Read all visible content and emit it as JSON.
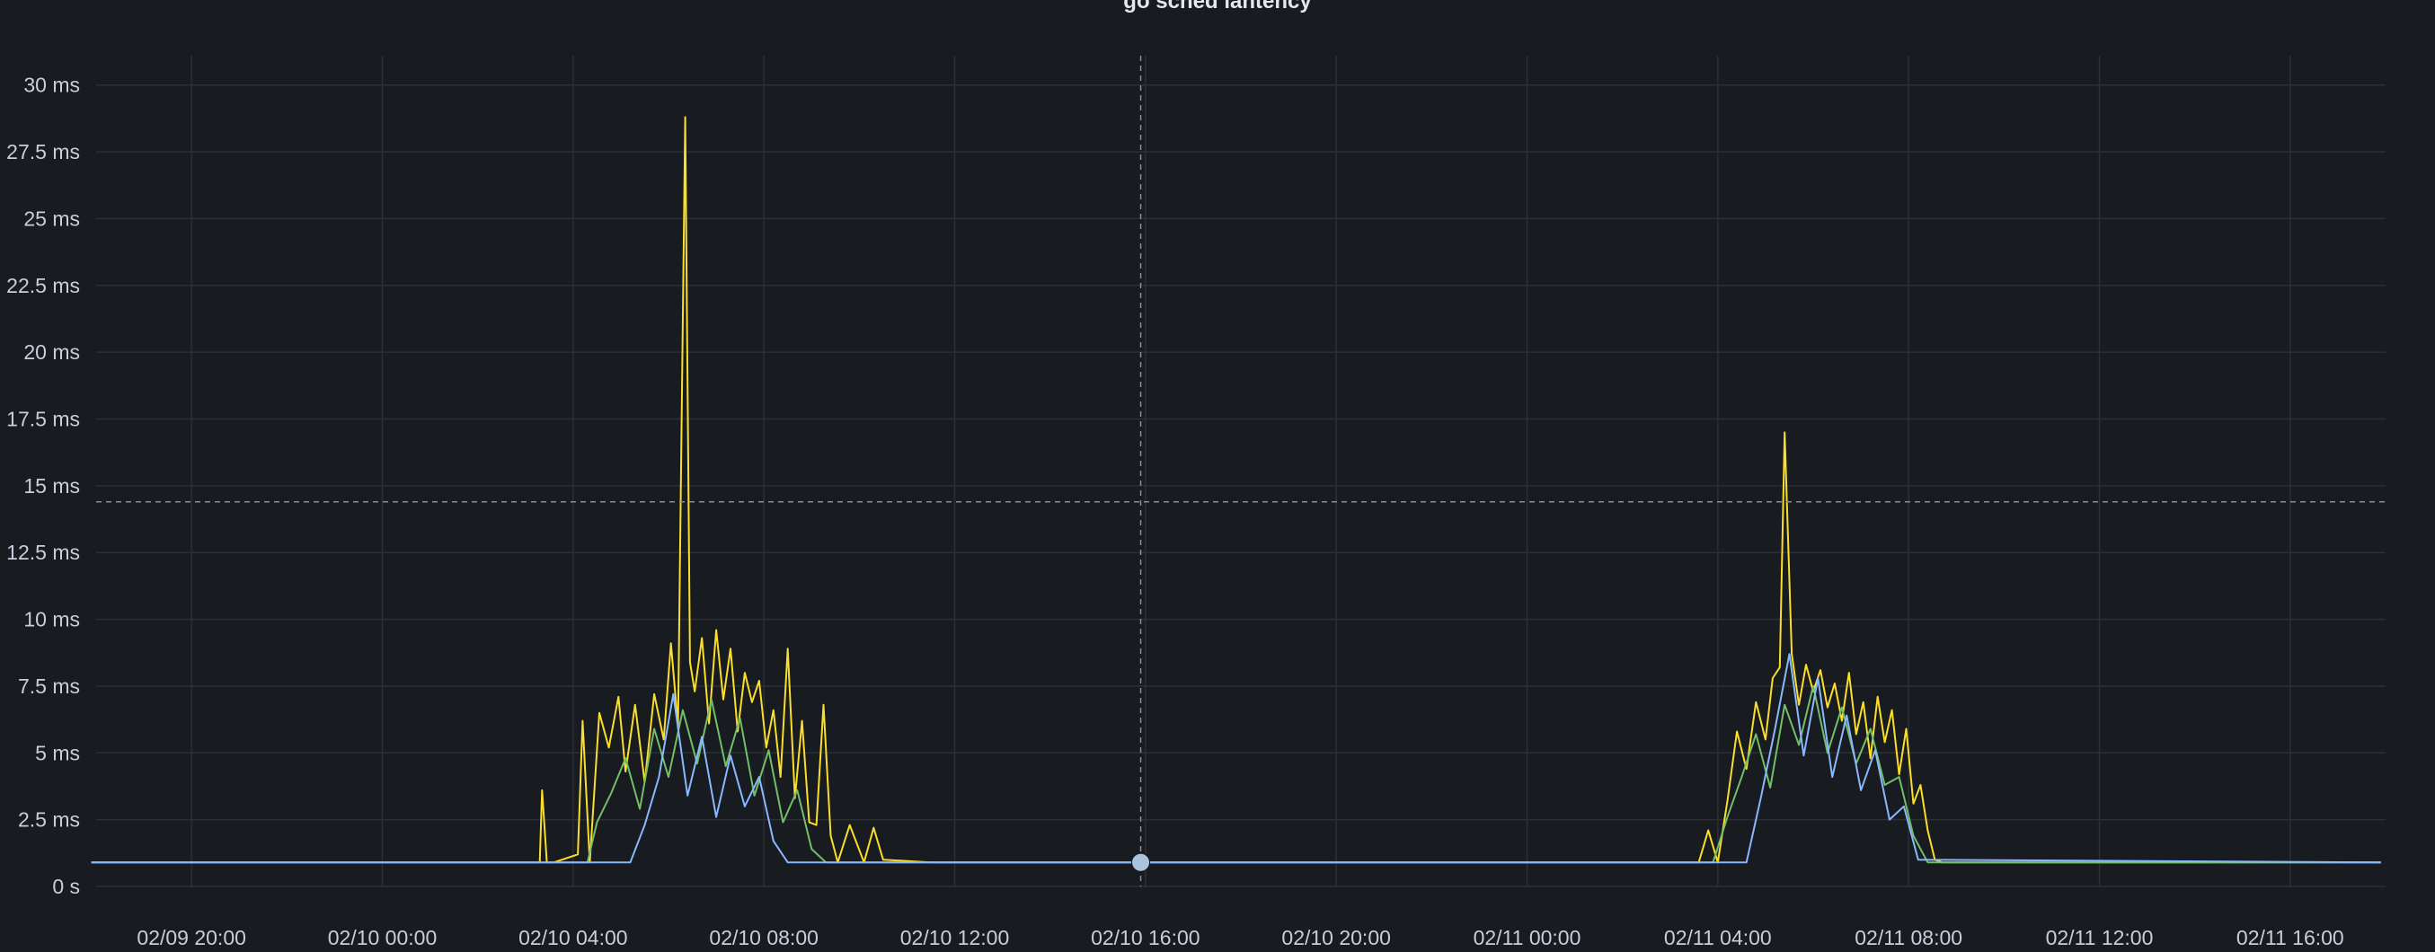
{
  "panel": {
    "title": "go sched lantency"
  },
  "chart_data": {
    "type": "line",
    "title": "go sched lantency",
    "xlabel": "",
    "ylabel": "",
    "ylim_ms": [
      0,
      31
    ],
    "y_ticks": [
      {
        "value_ms": 0,
        "label": "0 s"
      },
      {
        "value_ms": 2.5,
        "label": "2.5 ms"
      },
      {
        "value_ms": 5,
        "label": "5 ms"
      },
      {
        "value_ms": 7.5,
        "label": "7.5 ms"
      },
      {
        "value_ms": 10,
        "label": "10 ms"
      },
      {
        "value_ms": 12.5,
        "label": "12.5 ms"
      },
      {
        "value_ms": 15,
        "label": "15 ms"
      },
      {
        "value_ms": 17.5,
        "label": "17.5 ms"
      },
      {
        "value_ms": 20,
        "label": "20 ms"
      },
      {
        "value_ms": 22.5,
        "label": "22.5 ms"
      },
      {
        "value_ms": 25,
        "label": "25 ms"
      },
      {
        "value_ms": 27.5,
        "label": "27.5 ms"
      },
      {
        "value_ms": 30,
        "label": "30 ms"
      }
    ],
    "xlim": [
      "02/09 18:00",
      "02/11 18:00"
    ],
    "x_ticks": [
      {
        "hour": 20,
        "label": "02/09 20:00"
      },
      {
        "hour": 24,
        "label": "02/10 00:00"
      },
      {
        "hour": 28,
        "label": "02/10 04:00"
      },
      {
        "hour": 32,
        "label": "02/10 08:00"
      },
      {
        "hour": 36,
        "label": "02/10 12:00"
      },
      {
        "hour": 40,
        "label": "02/10 16:00"
      },
      {
        "hour": 44,
        "label": "02/10 20:00"
      },
      {
        "hour": 48,
        "label": "02/11 00:00"
      },
      {
        "hour": 52,
        "label": "02/11 04:00"
      },
      {
        "hour": 56,
        "label": "02/11 08:00"
      },
      {
        "hour": 60,
        "label": "02/11 12:00"
      },
      {
        "hour": 64,
        "label": "02/11 16:00"
      }
    ],
    "grid": true,
    "legend": "none",
    "crosshair": {
      "x_hour": 39.9,
      "y_ms": 14.4
    },
    "series": [
      {
        "color": "#fade2a",
        "x_hours": [
          17.9,
          26.3,
          27.3,
          27.35,
          27.45,
          27.6,
          28.1,
          28.2,
          28.35,
          28.55,
          28.75,
          28.95,
          29.1,
          29.3,
          29.5,
          29.7,
          29.9,
          30.05,
          30.2,
          30.35,
          30.45,
          30.55,
          30.7,
          30.85,
          31.0,
          31.15,
          31.3,
          31.45,
          31.6,
          31.75,
          31.9,
          32.05,
          32.2,
          32.35,
          32.5,
          32.65,
          32.8,
          32.95,
          33.1,
          33.25,
          33.4,
          33.55,
          33.8,
          34.1,
          34.3,
          34.5,
          35.5,
          49.5,
          51.6,
          51.8,
          52.0,
          52.2,
          52.4,
          52.6,
          52.8,
          53.0,
          53.15,
          53.3,
          53.4,
          53.55,
          53.7,
          53.85,
          54.0,
          54.15,
          54.3,
          54.45,
          54.6,
          54.75,
          54.9,
          55.05,
          55.2,
          55.35,
          55.5,
          55.65,
          55.8,
          55.95,
          56.1,
          56.25,
          56.4,
          56.55,
          56.7,
          56.85,
          57.0,
          57.15,
          57.3,
          57.45,
          57.6,
          57.75,
          57.9,
          58.05,
          58.2,
          58.4,
          58.6,
          58.8,
          59.0,
          60.0,
          65.9
        ],
        "values_ms": [
          0.9,
          0.9,
          0.9,
          3.6,
          0.9,
          0.9,
          1.2,
          6.2,
          0.9,
          6.5,
          5.2,
          7.1,
          4.3,
          6.8,
          3.9,
          7.2,
          5.5,
          9.1,
          6.0,
          28.8,
          8.4,
          7.3,
          9.3,
          6.1,
          9.6,
          7.0,
          8.9,
          5.8,
          8.0,
          6.9,
          7.7,
          5.2,
          6.6,
          4.1,
          8.9,
          3.3,
          6.2,
          2.4,
          2.3,
          6.8,
          1.9,
          0.9,
          2.3,
          0.9,
          2.2,
          1.0,
          0.9,
          0.9,
          0.9,
          2.1,
          0.9,
          3.2,
          5.8,
          4.4,
          6.9,
          5.5,
          7.8,
          8.2,
          17.0,
          8.7,
          6.8,
          8.3,
          7.3,
          8.1,
          6.7,
          7.6,
          6.2,
          8.0,
          5.7,
          6.9,
          4.8,
          7.1,
          5.4,
          6.6,
          4.2,
          5.9,
          3.1,
          3.8,
          2.1,
          1.0,
          0.9,
          0.9,
          0.9,
          0.9,
          0.9,
          0.9,
          0.9,
          0.9,
          0.9,
          0.9,
          0.9,
          0.9,
          0.9,
          0.9,
          0.9,
          0.9,
          0.9
        ]
      },
      {
        "color": "#73bf69",
        "x_hours": [
          17.9,
          28.3,
          28.5,
          28.8,
          29.1,
          29.4,
          29.7,
          30.0,
          30.3,
          30.6,
          30.9,
          31.2,
          31.5,
          31.8,
          32.1,
          32.4,
          32.7,
          33.0,
          33.3,
          51.9,
          52.2,
          52.5,
          52.8,
          53.1,
          53.4,
          53.7,
          54.0,
          54.3,
          54.6,
          54.9,
          55.2,
          55.5,
          55.8,
          56.1,
          56.4,
          65.9
        ],
        "values_ms": [
          0.9,
          0.9,
          2.4,
          3.5,
          4.8,
          2.9,
          5.9,
          4.1,
          6.6,
          4.6,
          7.0,
          4.5,
          6.3,
          3.4,
          5.1,
          2.4,
          3.6,
          1.4,
          0.9,
          0.9,
          2.6,
          4.1,
          5.7,
          3.7,
          6.8,
          5.3,
          7.5,
          5.0,
          6.7,
          4.6,
          5.9,
          3.8,
          4.1,
          1.9,
          0.9,
          0.9
        ]
      },
      {
        "color": "#8ab8ff",
        "x_hours": [
          17.9,
          29.2,
          29.5,
          29.8,
          30.1,
          30.4,
          30.7,
          31.0,
          31.3,
          31.6,
          31.9,
          32.2,
          32.5,
          52.6,
          52.9,
          53.2,
          53.5,
          53.8,
          54.1,
          54.4,
          54.7,
          55.0,
          55.3,
          55.6,
          55.9,
          56.2,
          65.9
        ],
        "values_ms": [
          0.9,
          0.9,
          2.3,
          4.1,
          7.2,
          3.4,
          5.6,
          2.6,
          4.9,
          3.0,
          4.1,
          1.7,
          0.9,
          0.9,
          3.3,
          5.9,
          8.7,
          4.9,
          7.8,
          4.1,
          6.4,
          3.6,
          5.1,
          2.5,
          3.0,
          1.0,
          0.9
        ]
      }
    ]
  }
}
